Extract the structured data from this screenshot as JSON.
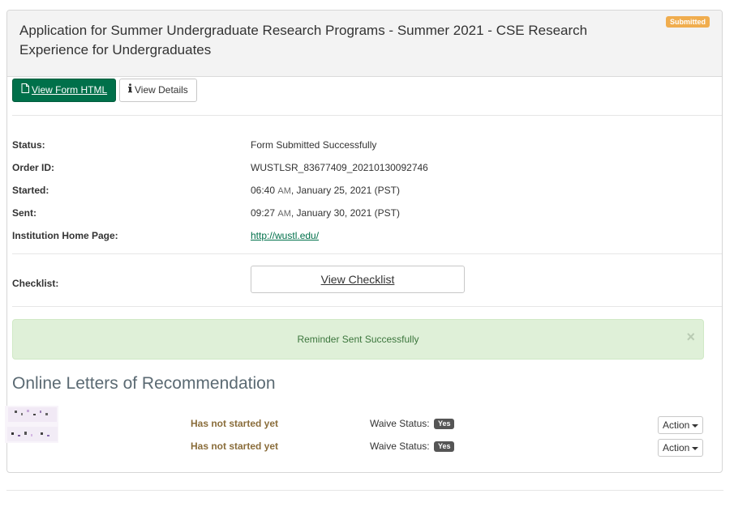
{
  "application": {
    "title": "Application for Summer Undergraduate Research Programs - Summer 2021 - CSE Research Experience for Undergraduates",
    "status_badge": "Submitted"
  },
  "toolbar": {
    "view_form_label": "View Form HTML",
    "view_details_label": "View Details",
    "view_form_icon": "file-icon",
    "view_details_icon": "info-icon"
  },
  "details": {
    "status_label": "Status:",
    "status_value": "Form Submitted Successfully",
    "order_id_label": "Order ID:",
    "order_id_value": "WUSTLSR_83677409_20210130092746",
    "started_label": "Started:",
    "started_time": "06:40",
    "started_ampm": "AM",
    "started_date": ", January 25, 2021 (PST)",
    "sent_label": "Sent:",
    "sent_time": "09:27",
    "sent_ampm": "AM",
    "sent_date": ", January 30, 2021 (PST)",
    "home_page_label": "Institution Home Page:",
    "home_page_url": "http://wustl.edu/"
  },
  "checklist": {
    "label": "Checklist:",
    "button_label": "View Checklist"
  },
  "alert": {
    "message": "Reminder Sent Successfully",
    "close": "×"
  },
  "recommendations": {
    "title": "Online Letters of Recommendation",
    "items": [
      {
        "status": "Has not started yet",
        "waive_label": "Waive Status:",
        "waive_value": "Yes",
        "action_label": "Action"
      },
      {
        "status": "Has not started yet",
        "waive_label": "Waive Status:",
        "waive_value": "Yes",
        "action_label": "Action"
      }
    ]
  },
  "colors": {
    "primary": "#00704a",
    "badge_submitted": "#f0ad4e",
    "alert_bg": "#dff0d8",
    "alert_text": "#3c763d",
    "rec_status": "#8a6d3b"
  }
}
